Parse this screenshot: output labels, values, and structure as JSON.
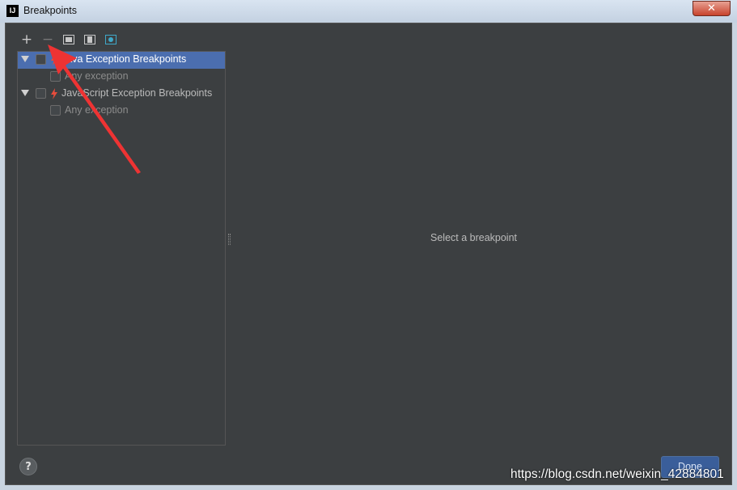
{
  "window": {
    "title": "Breakpoints",
    "app_icon_text": "IJ",
    "close_glyph": "✕"
  },
  "toolbar": {
    "add": "+",
    "remove": "−",
    "icons": [
      "add-icon",
      "remove-icon",
      "group-by-package-icon",
      "group-by-file-icon",
      "group-by-class-icon"
    ]
  },
  "tree": {
    "items": [
      {
        "label": "Java Exception Breakpoints",
        "selected": true,
        "checked": false
      },
      {
        "label": "Any exception",
        "checked": false
      },
      {
        "label": "JavaScript Exception Breakpoints",
        "selected": false,
        "checked": false
      },
      {
        "label": "Any exception",
        "checked": false
      }
    ]
  },
  "detail": {
    "placeholder": "Select a breakpoint"
  },
  "footer": {
    "help": "?",
    "done": "Done"
  },
  "watermark": "https://blog.csdn.net/weixin_42884801",
  "colors": {
    "panel": "#3c3f41",
    "selection": "#4b6eaf",
    "bolt": "#e74c3c",
    "annotation_arrow": "#ee3333"
  }
}
